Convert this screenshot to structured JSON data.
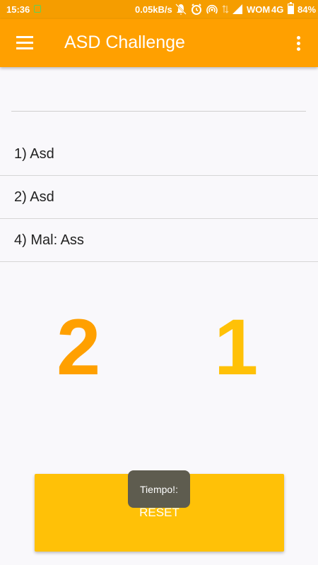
{
  "status_bar": {
    "time": "15:36",
    "speed": "0.05kB/s",
    "carrier": "WOM",
    "network": "4G",
    "battery": "84%",
    "icons": [
      "notifications-off-icon",
      "alarm-icon",
      "hotspot-icon",
      "data-arrows-icon",
      "signal-icon"
    ]
  },
  "app_bar": {
    "title": "ASD Challenge",
    "color": "#ffa000"
  },
  "input": {
    "value": ""
  },
  "answers": [
    {
      "label": "1) Asd"
    },
    {
      "label": "2) Asd"
    },
    {
      "label": "4) Mal: Ass"
    }
  ],
  "scores": {
    "left": "2",
    "right": "1",
    "left_color": "#ffa000",
    "right_color": "#ffc107"
  },
  "reset_button": {
    "label": "RESET",
    "color": "#ffc107"
  },
  "toast": {
    "text": "Tiempo!:"
  }
}
